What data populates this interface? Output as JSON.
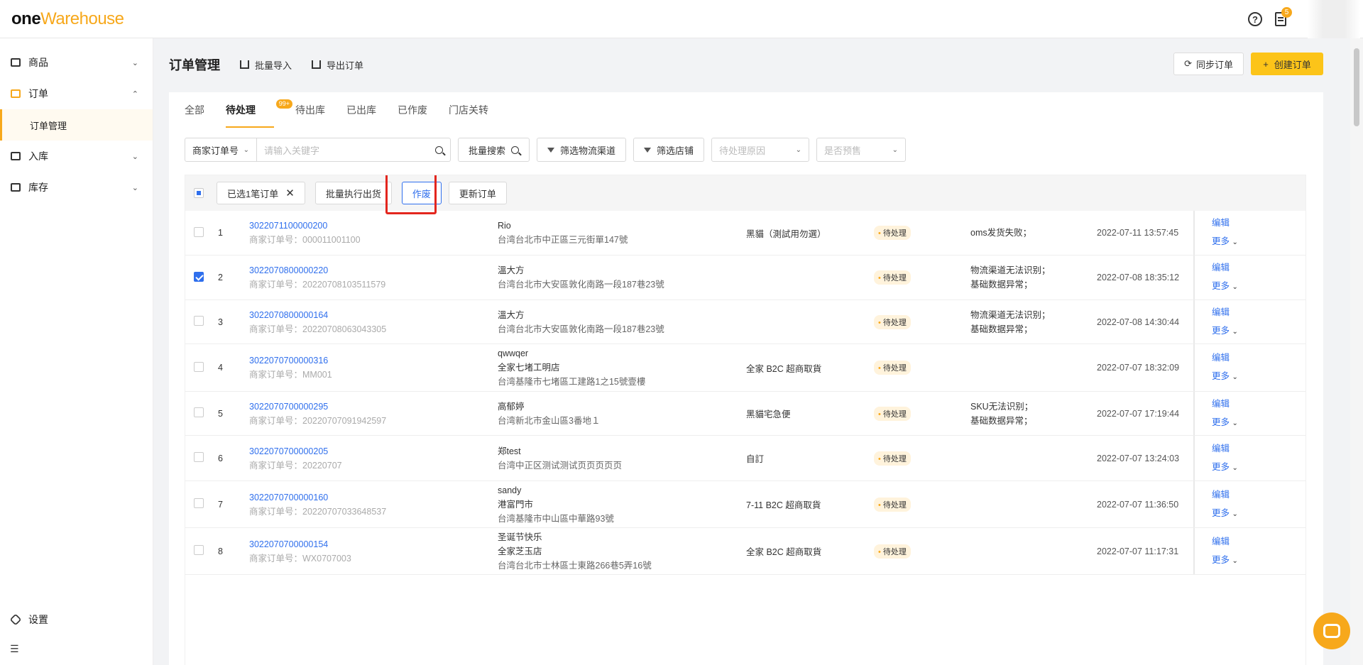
{
  "app": {
    "logo_one": "one",
    "logo_wh": "Warehouse"
  },
  "topbar": {
    "notice_count": "5",
    "help_icon": "question-circle-icon",
    "notice_icon": "clipboard-icon"
  },
  "sidebar": {
    "items": [
      {
        "label": "商品",
        "icon": "box-icon",
        "expanded": false
      },
      {
        "label": "订单",
        "icon": "order-icon",
        "expanded": true
      },
      {
        "label": "订单管理",
        "sub": true
      },
      {
        "label": "入库",
        "icon": "store-icon",
        "expanded": false
      },
      {
        "label": "库存",
        "icon": "warehouse-icon",
        "expanded": false
      }
    ],
    "settings_label": "设置",
    "collapse_glyph": "☰"
  },
  "header": {
    "title": "订单管理",
    "import_label": "批量导入",
    "export_label": "导出订单",
    "sync_label": "同步订单",
    "create_label": "创建订单"
  },
  "tabs": [
    {
      "label": "全部"
    },
    {
      "label": "待处理",
      "badge": "99+",
      "active": true
    },
    {
      "label": "待出库"
    },
    {
      "label": "已出库"
    },
    {
      "label": "已作废"
    },
    {
      "label": "门店关转"
    }
  ],
  "filters": {
    "search_type": "商家订单号",
    "search_placeholder": "请输入关键字",
    "batch_search": "批量搜索",
    "filter_channel": "筛选物流渠道",
    "filter_store": "筛选店铺",
    "pending_reason_placeholder": "待处理原因",
    "presale_placeholder": "是否预售"
  },
  "bulk": {
    "selected_label": "已选1笔订单",
    "execute_label": "批量执行出货",
    "void_label": "作废",
    "update_label": "更新订单"
  },
  "accent_colors": {
    "brand": "#f7a81b",
    "link": "#2f6fed",
    "highlight": "#e3261e"
  },
  "orders": [
    {
      "no": "1",
      "order_id": "3022071100000200",
      "merchant_no": "商家订单号：000011001100",
      "lines": [
        "Rio",
        "台湾台北市中正區三元街單147號"
      ],
      "channel": "黑貓（測試用勿選）",
      "status": "待处理",
      "reasons": [
        "oms发货失败；"
      ],
      "date": "2022-07-11 13:57:45",
      "checked": false,
      "height": 63
    },
    {
      "no": "2",
      "order_id": "3022070800000220",
      "merchant_no": "商家订单号：20220708103511579",
      "lines": [
        "溫大方",
        "台湾台北市大安區敦化南路一段187巷23號"
      ],
      "channel": "",
      "status": "待处理",
      "reasons": [
        "物流渠道无法识别；",
        "基础数据异常；"
      ],
      "date": "2022-07-08 18:35:12",
      "checked": true,
      "height": 63
    },
    {
      "no": "3",
      "order_id": "3022070800000164",
      "merchant_no": "商家订单号：20220708063043305",
      "lines": [
        "溫大方",
        "台湾台北市大安區敦化南路一段187巷23號"
      ],
      "channel": "",
      "status": "待处理",
      "reasons": [
        "物流渠道无法识别；",
        "基础数据异常；"
      ],
      "date": "2022-07-08 14:30:44",
      "checked": false,
      "height": 62
    },
    {
      "no": "4",
      "order_id": "3022070700000316",
      "merchant_no": "商家订单号：MM001",
      "lines": [
        "qwwqer",
        "全家七堵工明店",
        "台湾基隆市七堵區工建路1之15號壹樓"
      ],
      "channel": "全家 B2C 超商取貨",
      "status": "待处理",
      "reasons": [],
      "date": "2022-07-07 18:32:09",
      "checked": false,
      "height": 67
    },
    {
      "no": "5",
      "order_id": "3022070700000295",
      "merchant_no": "商家订单号：20220707091942597",
      "lines": [
        "高郁婷",
        "台湾新北市金山區3番地１"
      ],
      "channel": "黑貓宅急便",
      "status": "待处理",
      "reasons": [
        "SKU无法识别；",
        "基础数据异常；"
      ],
      "date": "2022-07-07 17:19:44",
      "checked": false,
      "height": 62
    },
    {
      "no": "6",
      "order_id": "3022070700000205",
      "merchant_no": "商家订单号：20220707",
      "lines": [
        "郑test",
        "台湾中正区测试测试页页页页页"
      ],
      "channel": "自訂",
      "status": "待处理",
      "reasons": [],
      "date": "2022-07-07 13:24:03",
      "checked": false,
      "height": 64
    },
    {
      "no": "7",
      "order_id": "3022070700000160",
      "merchant_no": "商家订单号：20220707033648537",
      "lines": [
        "sandy",
        "港富門市",
        "台湾基隆市中山區中華路93號"
      ],
      "channel": "7-11 B2C 超商取貨",
      "status": "待处理",
      "reasons": [],
      "date": "2022-07-07 11:36:50",
      "checked": false,
      "height": 66
    },
    {
      "no": "8",
      "order_id": "3022070700000154",
      "merchant_no": "商家订单号：WX0707003",
      "lines": [
        "圣诞节快乐",
        "全家芝玉店",
        "台湾台北市士林區士東路266巷5弄16號"
      ],
      "channel": "全家 B2C 超商取貨",
      "status": "待处理",
      "reasons": [],
      "date": "2022-07-07 11:17:31",
      "checked": false,
      "height": 66
    }
  ],
  "row_actions": {
    "edit": "编辑",
    "more": "更多"
  }
}
